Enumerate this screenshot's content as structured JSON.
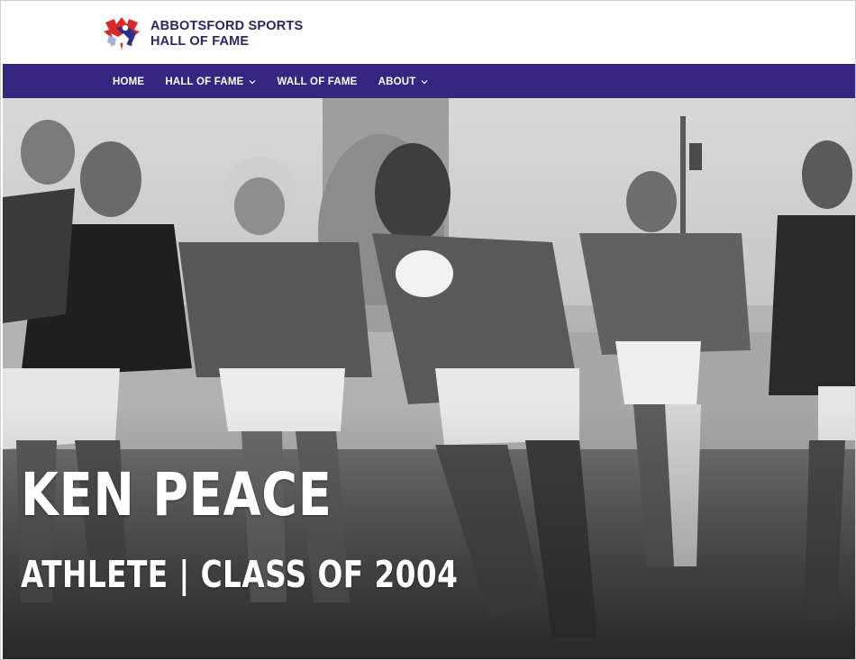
{
  "header": {
    "logo_icon": "abbotsford-hof-logo",
    "title_line1": "ABBOTSFORD SPORTS",
    "title_line2": "HALL OF FAME"
  },
  "nav": {
    "items": [
      {
        "label": "HOME",
        "has_dropdown": false
      },
      {
        "label": "HALL OF FAME",
        "has_dropdown": true
      },
      {
        "label": "WALL OF FAME",
        "has_dropdown": false
      },
      {
        "label": "ABOUT",
        "has_dropdown": true
      }
    ]
  },
  "hero": {
    "name": "KEN PEACE",
    "subtitle": "ATHLETE | CLASS OF 2004",
    "image_style": "black-and-white rugby photo"
  },
  "colors": {
    "nav_background": "#362681",
    "title_text": "#2b2560",
    "logo_red": "#d42a2a",
    "logo_blue": "#2b2f8a"
  }
}
